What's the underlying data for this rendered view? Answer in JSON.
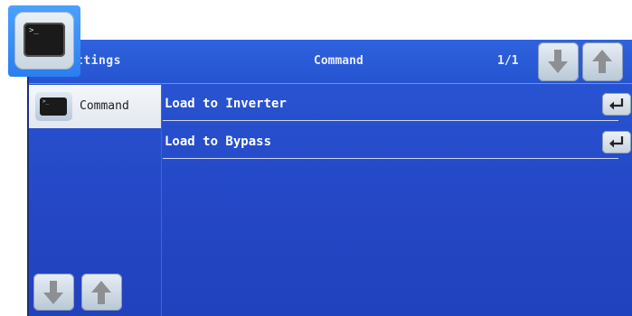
{
  "header": {
    "left_title": "ttings",
    "center_title": "Command",
    "page_indicator": "1/1"
  },
  "sidebar": {
    "items": [
      {
        "label": "Command",
        "icon": "terminal-icon",
        "selected": true
      }
    ]
  },
  "commands": [
    {
      "label": "Load to Inverter",
      "icon": "enter-icon"
    },
    {
      "label": "Load to Bypass",
      "icon": "enter-icon"
    }
  ],
  "icons": {
    "app": "terminal-icon",
    "page_down": "arrow-down-icon",
    "page_up": "arrow-up-icon"
  },
  "colors": {
    "background": "#2447c6",
    "text": "#ffffff",
    "selected_item": "#eef1f6",
    "highlight": "#3a8cf5"
  }
}
